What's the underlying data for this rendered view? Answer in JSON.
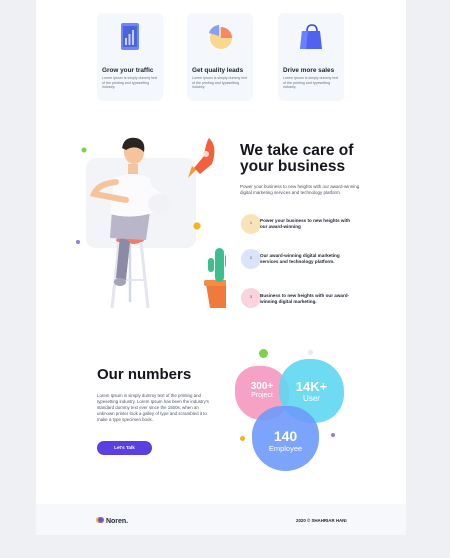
{
  "features": [
    {
      "title": "Grow your traffic",
      "desc": "Lorem ipsum is simply dummy text of the printing and typesetting industry.",
      "icon": "chart-tablet-icon"
    },
    {
      "title": "Get quality leads",
      "desc": "Lorem ipsum is simply dummy text of the printing and typesetting industry.",
      "icon": "pie-chart-icon"
    },
    {
      "title": "Drive more sales",
      "desc": "Lorem ipsum is simply dummy text of the printing and typesetting industry.",
      "icon": "shopping-bag-icon"
    }
  ],
  "about": {
    "heading_line1": "We take care of",
    "heading_line2": "your business",
    "lead": "Power your business to new heights with our award-winning digital marketing services and technology platform.",
    "items": [
      {
        "num": "1",
        "text": "Power your business to new heights with our award-winning",
        "color": "#f7e3b7"
      },
      {
        "num": "2",
        "text": "Our award-winning digital marketing services and technology platform.",
        "color": "#dbe3fb"
      },
      {
        "num": "3",
        "text": "Business to new heights with our award-winning digital marketing.",
        "color": "#f9d4dd"
      }
    ]
  },
  "numbers": {
    "heading": "Our numbers",
    "para": "Lorem Ipsum is simply dummy text of the printing and typesetting industry. Lorem Ipsum has been the industry's standard dummy text ever since the 1500s, when an unknown printer took a galley of type and scrambled it to make a type specimen book.",
    "button": "Let's Talk",
    "stats": [
      {
        "value": "300+",
        "label": "Project",
        "color": "#f59bbf"
      },
      {
        "value": "14K+",
        "label": "User",
        "color": "#5fd8f1"
      },
      {
        "value": "140",
        "label": "Employee",
        "color": "#6e9bfa"
      }
    ]
  },
  "footer": {
    "logo": "Noren.",
    "copyright": "2020 © SHAHRIAR HANI"
  },
  "colors": {
    "accent": "#5b3fe0",
    "page_bg": "#eef0f4"
  }
}
